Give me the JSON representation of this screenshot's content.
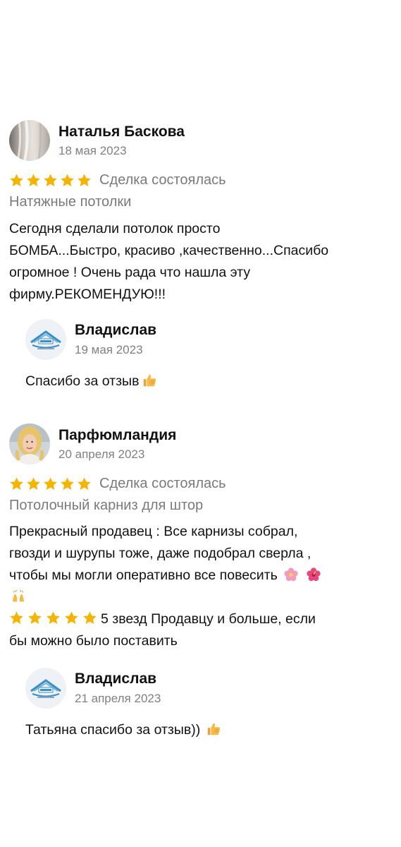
{
  "colors": {
    "star": "#f6b400",
    "muted_text": "#7a7a7a",
    "date_text": "#808080",
    "main_text": "#111111"
  },
  "reviews": [
    {
      "author": "Наталья Баскова",
      "date": "18 мая 2023",
      "rating": 5,
      "deal_status": "Сделка состоялась",
      "category": "Натяжные потолки",
      "text_lines": [
        "Сегодня сделали потолок просто",
        "БОМБА...Быстро, красиво ,качественно...Спасибо",
        "огромное ! Очень рада что нашла эту",
        "фирму.РЕКОМЕНДУЮ!!!"
      ],
      "reply": {
        "author": "Владислав",
        "date": "19 мая 2023",
        "text": "Спасибо за отзыв"
      }
    },
    {
      "author": "Парфюмландия",
      "date": "20 апреля 2023",
      "rating": 5,
      "deal_status": "Сделка состоялась",
      "category": "Потолочный карниз для штор",
      "text_lines": [
        "Прекрасный продавец : Все карнизы собрал,",
        "гвозди и шурупы тоже, даже подобрал сверла ,",
        "чтобы мы могли оперативно все повесить"
      ],
      "text_extra_line1": "5 звезд Продавцу и больше, если",
      "text_extra_line2": "бы можно было поставить",
      "reply": {
        "author": "Владислав",
        "date": "21 апреля 2023",
        "text": "Татьяна спасибо за отзыв))"
      }
    }
  ],
  "icons": {
    "thumbs_up": "thumbs-up-icon",
    "flower": "flower-icon",
    "hibiscus": "hibiscus-icon",
    "raised_hands": "raised-hands-icon",
    "star": "star-icon"
  }
}
